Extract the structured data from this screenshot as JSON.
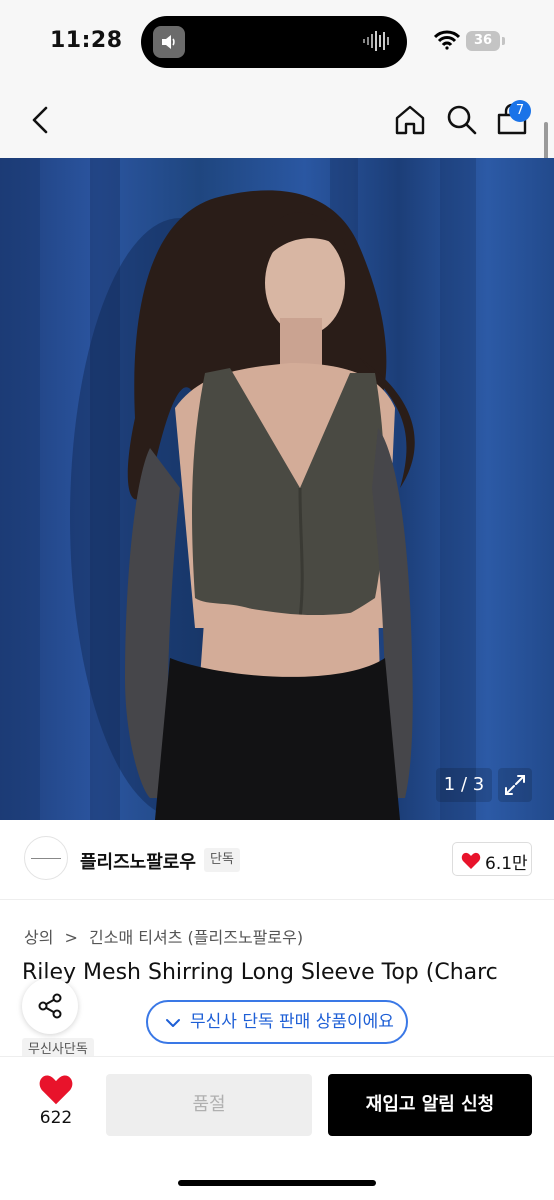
{
  "status_bar": {
    "time": "11:28",
    "battery": "36"
  },
  "nav": {
    "cart_badge": "7",
    "icons": [
      "back-chevron-icon",
      "home-icon",
      "search-icon",
      "cart-icon"
    ]
  },
  "product_image": {
    "counter": "1 / 3",
    "description_icon": "expand-icon"
  },
  "brand": {
    "name": "플리즈노팔로우",
    "tag": "단독",
    "like_count": "6.1만"
  },
  "breadcrumb": {
    "category": "상의",
    "separator": ">",
    "subcategory": "긴소매 티셔츠 (플리즈노팔로우)"
  },
  "product": {
    "title": "Riley Mesh Shirring Long Sleeve Top (Charc",
    "exclusive_tag": "무신사단독"
  },
  "exclusive_pill": {
    "label": "무신사 단독 판매 상품이에요"
  },
  "action_bar": {
    "wish_count": "622",
    "soldout_label": "품절",
    "restock_label": "재입고 알림 신청"
  },
  "colors": {
    "accent_blue": "#3a78e6",
    "badge_blue": "#1a73e8",
    "heart_red": "#e8132b",
    "primary_black": "#000000"
  }
}
